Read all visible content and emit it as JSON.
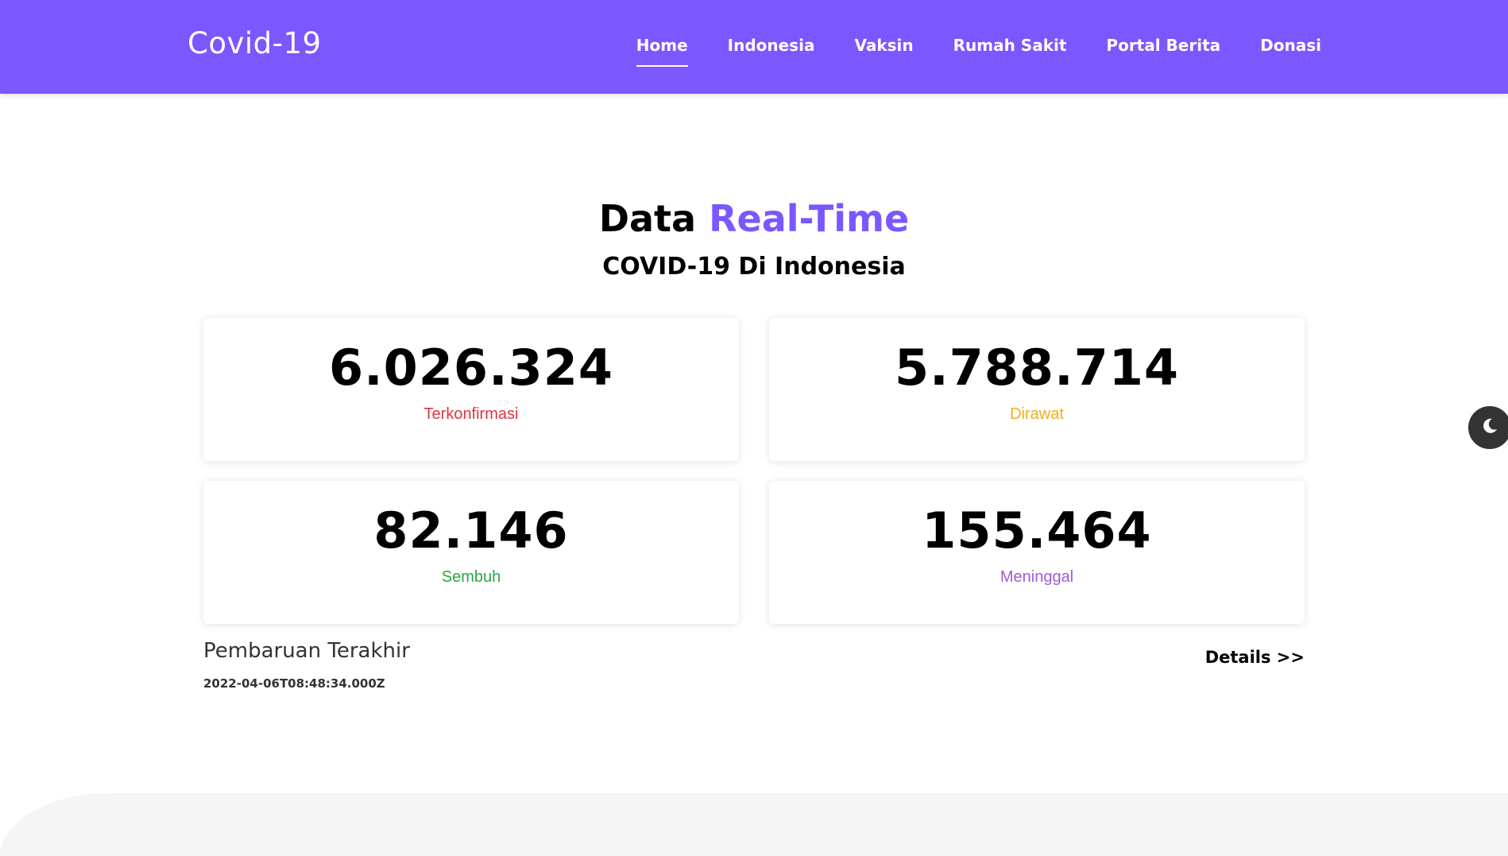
{
  "header": {
    "brand": "Covid-19",
    "nav": [
      "Home",
      "Indonesia",
      "Vaksin",
      "Rumah Sakit",
      "Portal Berita",
      "Donasi"
    ],
    "active": "Home",
    "background_color": "#7b57ff"
  },
  "main": {
    "title_prefix": "Data",
    "title_accent": "Real-Time",
    "subtitle": "COVID-19 Di Indonesia",
    "stats": [
      {
        "value": "6.026.324",
        "label": "Terkonfirmasi",
        "color": "#dc3545"
      },
      {
        "value": "5.788.714",
        "label": "Dirawat",
        "color": "#f0ad1c"
      },
      {
        "value": "82.146",
        "label": "Sembuh",
        "color": "#28a745"
      },
      {
        "value": "155.464",
        "label": "Meninggal",
        "color": "#a259d9"
      }
    ],
    "update_title": "Pembaruan Terakhir",
    "update_time": "2022-04-06T08:48:34.000Z",
    "details_link": "Details >>"
  },
  "theme_toggle": {
    "icon": "moon-icon"
  }
}
